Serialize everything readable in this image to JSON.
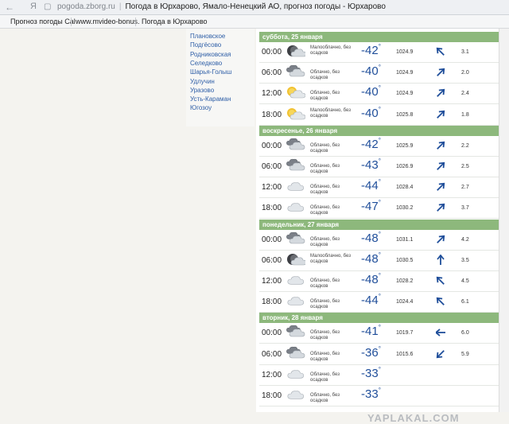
{
  "browser": {
    "url": "pogoda.zborg.ru",
    "title": "Погода в Юрхарово, Ямало-Ненецкий АО, прогноз погоды - Юрхарово",
    "bookmarks": [
      "Прогноз погоды Cal",
      "www.mvideo-bonus.",
      "Погода в Юрхарово"
    ]
  },
  "locations": [
    "Плановское",
    "Подгёсово",
    "Родниковская",
    "Селедково",
    "Шарья-Голыш",
    "Удлучин",
    "Уразово",
    "Усть-Караман",
    "Югозоу"
  ],
  "days": [
    {
      "header": "суббота, 25 января",
      "rows": [
        {
          "time": "00:00",
          "icon": "night-partly-cloudy-icon",
          "cond": "Малооблачно, без осадков",
          "temp": "-42",
          "pres": "1024.9",
          "wind_dir": "north-west",
          "wind_speed": "3.1"
        },
        {
          "time": "06:00",
          "icon": "cloudy-icon",
          "cond": "Облачно, без осадков",
          "temp": "-40",
          "pres": "1024.9",
          "wind_dir": "north-east",
          "wind_speed": "2.0"
        },
        {
          "time": "12:00",
          "icon": "sun-cloud-icon",
          "cond": "Облачно, без осадков",
          "temp": "-40",
          "pres": "1024.9",
          "wind_dir": "north-east",
          "wind_speed": "2.4"
        },
        {
          "time": "18:00",
          "icon": "sun-cloud-icon",
          "cond": "Малооблачно, без осадков",
          "temp": "-40",
          "pres": "1025.8",
          "wind_dir": "north-east",
          "wind_speed": "1.8"
        }
      ]
    },
    {
      "header": "воскресенье, 26 января",
      "rows": [
        {
          "time": "00:00",
          "icon": "cloudy-icon",
          "cond": "Облачно, без осадков",
          "temp": "-42",
          "pres": "1025.9",
          "wind_dir": "north-east",
          "wind_speed": "2.2"
        },
        {
          "time": "06:00",
          "icon": "cloudy-icon",
          "cond": "Облачно, без осадков",
          "temp": "-43",
          "pres": "1026.9",
          "wind_dir": "north-east",
          "wind_speed": "2.5"
        },
        {
          "time": "12:00",
          "icon": "cloud-icon",
          "cond": "Облачно, без осадков",
          "temp": "-44",
          "pres": "1028.4",
          "wind_dir": "north-east",
          "wind_speed": "2.7"
        },
        {
          "time": "18:00",
          "icon": "cloud-icon",
          "cond": "Облачно, без осадков",
          "temp": "-47",
          "pres": "1030.2",
          "wind_dir": "north-east",
          "wind_speed": "3.7"
        }
      ]
    },
    {
      "header": "понедельник, 27 января",
      "rows": [
        {
          "time": "00:00",
          "icon": "cloudy-icon",
          "cond": "Облачно, без осадков",
          "temp": "-48",
          "pres": "1031.1",
          "wind_dir": "north-east",
          "wind_speed": "4.2"
        },
        {
          "time": "06:00",
          "icon": "night-partly-cloudy-icon",
          "cond": "Малооблачно, без осадков",
          "temp": "-48",
          "pres": "1030.5",
          "wind_dir": "north",
          "wind_speed": "3.5"
        },
        {
          "time": "12:00",
          "icon": "cloud-icon",
          "cond": "Облачно, без осадков",
          "temp": "-48",
          "pres": "1028.2",
          "wind_dir": "north-west",
          "wind_speed": "4.5"
        },
        {
          "time": "18:00",
          "icon": "cloud-icon",
          "cond": "Облачно, без осадков",
          "temp": "-44",
          "pres": "1024.4",
          "wind_dir": "north-west",
          "wind_speed": "6.1"
        }
      ]
    },
    {
      "header": "вторник, 28 января",
      "rows": [
        {
          "time": "00:00",
          "icon": "cloudy-icon",
          "cond": "Облачно, без осадков",
          "temp": "-41",
          "pres": "1019.7",
          "wind_dir": "west",
          "wind_speed": "6.0"
        },
        {
          "time": "06:00",
          "icon": "cloudy-icon",
          "cond": "Облачно, без осадков",
          "temp": "-36",
          "pres": "1015.6",
          "wind_dir": "south-west",
          "wind_speed": "5.9"
        },
        {
          "time": "12:00",
          "icon": "cloud-icon",
          "cond": "Облачно, без осадков",
          "temp": "-33",
          "pres": "",
          "wind_dir": "",
          "wind_speed": ""
        },
        {
          "time": "18:00",
          "icon": "cloud-icon",
          "cond": "Облачно, без осадков",
          "temp": "-33",
          "pres": "",
          "wind_dir": "",
          "wind_speed": ""
        }
      ]
    }
  ],
  "watermark": "YAPLAKAL.COM",
  "colors": {
    "day_header": "#8db87c",
    "temp": "#1f4e9a",
    "arrow": "#1f4e9a",
    "link": "#2f5fa7"
  }
}
